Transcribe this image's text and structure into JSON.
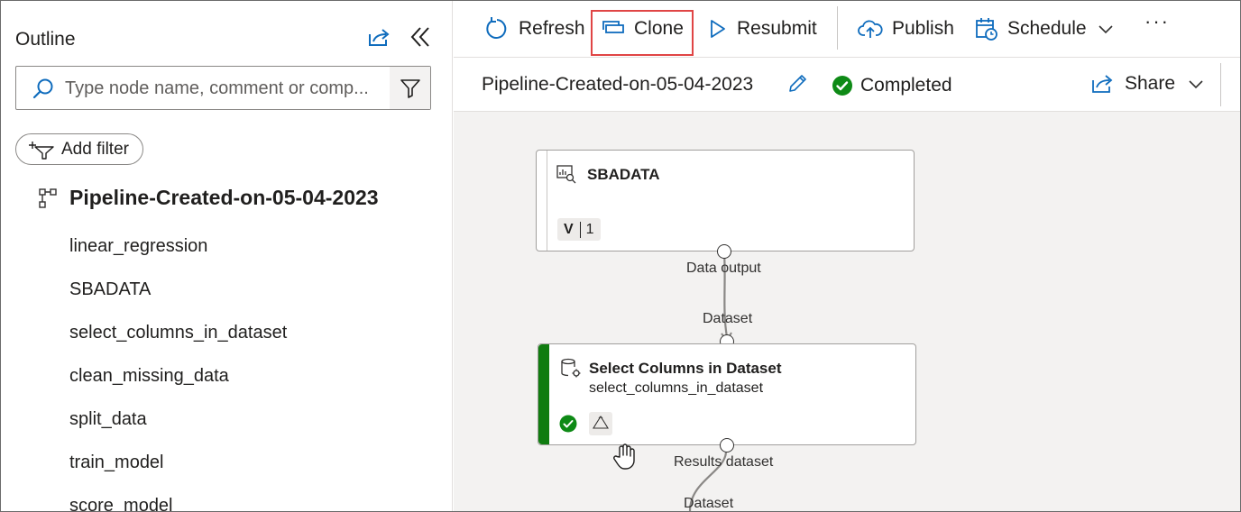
{
  "outline": {
    "title": "Outline",
    "search_placeholder": "Type node name, comment or comp...",
    "add_filter_label": "Add filter",
    "root_label": "Pipeline-Created-on-05-04-2023",
    "items": [
      "linear_regression",
      "SBADATA",
      "select_columns_in_dataset",
      "clean_missing_data",
      "split_data",
      "train_model",
      "score_model"
    ]
  },
  "toolbar": {
    "refresh_label": "Refresh",
    "clone_label": "Clone",
    "resubmit_label": "Resubmit",
    "publish_label": "Publish",
    "schedule_label": "Schedule",
    "more_label": "···"
  },
  "header": {
    "pipeline_title": "Pipeline-Created-on-05-04-2023",
    "status": "Completed",
    "share_label": "Share"
  },
  "canvas": {
    "node1": {
      "title": "SBADATA",
      "version_prefix": "V",
      "version_number": "1",
      "output_label": "Data output"
    },
    "node2": {
      "input_label": "Dataset",
      "title": "Select Columns in Dataset",
      "subtitle": "select_columns_in_dataset",
      "output_label": "Results dataset"
    },
    "node3": {
      "input_label": "Dataset"
    }
  },
  "colors": {
    "accent_blue": "#0f6cbd",
    "success_green": "#107c10",
    "highlight_red": "#e04545",
    "canvas_bg": "#f3f2f1"
  }
}
